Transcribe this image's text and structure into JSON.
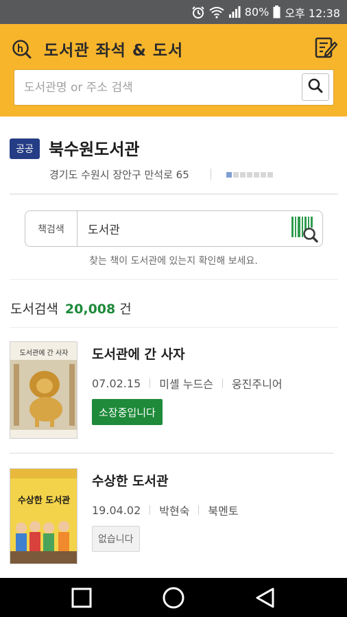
{
  "status_bar": {
    "battery": "80%",
    "time": "오후 12:38",
    "icons": [
      "alarm-icon",
      "wifi-icon",
      "signal-icon",
      "battery-icon"
    ]
  },
  "header": {
    "title": "도서관 좌석 & 도서",
    "search_placeholder": "도서관명 or 주소 검색",
    "icons": [
      "library-logo-icon",
      "edit-note-icon",
      "search-icon"
    ]
  },
  "library": {
    "badge": "공공",
    "name": "북수원도서관",
    "address": "경기도 수원시 장안구 만석로 65"
  },
  "book_search": {
    "label": "책검색",
    "value": "도서관",
    "hint": "찾는 책이 도서관에 있는지 확인해 보세요."
  },
  "results": {
    "label": "도서검색",
    "count": "20,008",
    "unit": "건"
  },
  "books": [
    {
      "title": "도서관에 간 사자",
      "date": "07.02.15",
      "author": "미셸 누드슨",
      "publisher": "웅진주니어",
      "status": "소장중입니다",
      "cover_text": "도서관에 간 사자"
    },
    {
      "title": "수상한 도서관",
      "date": "19.04.02",
      "author": "박현숙",
      "publisher": "북멘토",
      "status": "없습니다",
      "cover_text": "수상한 도서관"
    }
  ],
  "colors": {
    "header_bg": "#f7b52c",
    "status_bar_bg": "#58595b",
    "badge_bg": "#253d84",
    "accent_green": "#1e8a3a",
    "nav_bar_bg": "#000000"
  }
}
